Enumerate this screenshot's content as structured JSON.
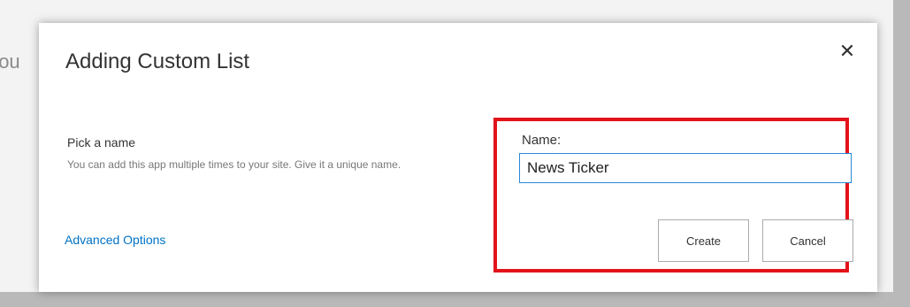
{
  "background": {
    "partial_text": "'ou"
  },
  "dialog": {
    "title": "Adding Custom List",
    "close_glyph": "✕",
    "close_icon": "close-icon",
    "pick_name_label": "Pick a name",
    "pick_name_description": "You can add this app multiple times to your site. Give it a unique name.",
    "advanced_link": "Advanced Options",
    "name_field_label": "Name:",
    "name_field_value": "News Ticker",
    "create_button": "Create",
    "cancel_button": "Cancel"
  },
  "colors": {
    "highlight_border": "#e3131b",
    "link": "#0072c6",
    "input_focus_border": "#2b88d8"
  }
}
